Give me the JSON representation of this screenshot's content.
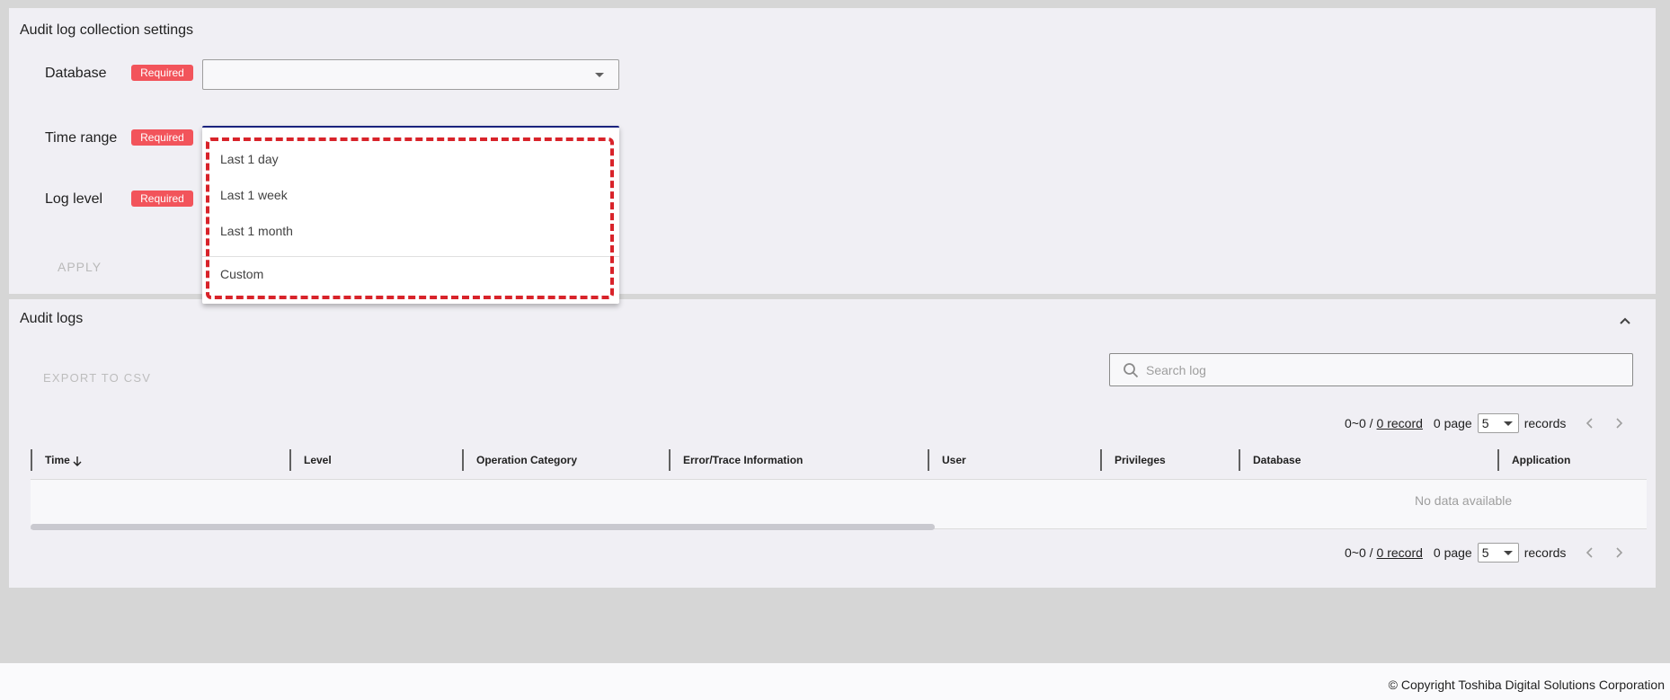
{
  "settings": {
    "title": "Audit log collection settings",
    "database_label": "Database",
    "time_range_label": "Time range",
    "log_level_label": "Log level",
    "required_badge": "Required",
    "apply_label": "APPLY",
    "time_range_options": [
      "Last 1 day",
      "Last 1 week",
      "Last 1 month",
      "Custom"
    ]
  },
  "logs": {
    "title": "Audit logs",
    "export_label": "EXPORT TO CSV",
    "search_placeholder": "Search log",
    "pager": {
      "range": "0~0 /",
      "record_link": "0 record",
      "page_text": "0 page",
      "per_page": "5",
      "records_text": "records"
    },
    "columns": [
      "Time",
      "Level",
      "Operation Category",
      "Error/Trace Information",
      "User",
      "Privileges",
      "Database",
      "Application"
    ],
    "empty_text": "No data available"
  },
  "footer": {
    "copyright": "© Copyright Toshiba Digital Solutions Corporation"
  },
  "colors": {
    "required_badge": "#f2545b",
    "highlight_border": "#d8232a",
    "focus_border": "#1a237e"
  }
}
